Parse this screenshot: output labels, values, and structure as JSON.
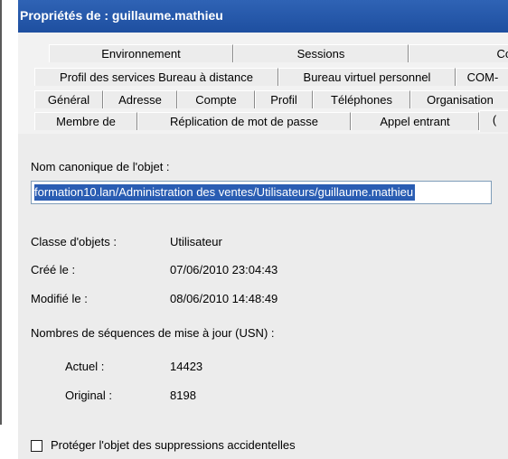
{
  "window": {
    "title": "Propriétés de : guillaume.mathieu"
  },
  "tabs": {
    "row1": [
      "Environnement",
      "Sessions",
      "Cont"
    ],
    "row2": [
      "Profil des services Bureau à distance",
      "Bureau virtuel personnel",
      "COM-"
    ],
    "row3": [
      "Général",
      "Adresse",
      "Compte",
      "Profil",
      "Téléphones",
      "Organisation"
    ],
    "row4": [
      "Membre de",
      "Réplication de mot de passe",
      "Appel entrant",
      "("
    ]
  },
  "object": {
    "canonical_label": "Nom canonique de l'objet :",
    "canonical_value": "formation10.lan/Administration des ventes/Utilisateurs/guillaume.mathieu",
    "class_label": "Classe d'objets :",
    "class_value": "Utilisateur",
    "created_label": "Créé le :",
    "created_value": "07/06/2010 23:04:43",
    "modified_label": "Modifié le :",
    "modified_value": "08/06/2010 14:48:49",
    "usn_label": "Nombres de séquences de mise à jour (USN) :",
    "current_label": "Actuel :",
    "current_value": "14423",
    "original_label": "Original :",
    "original_value": "8198",
    "protect_label": "Protéger l'objet des suppressions accidentelles",
    "protect_checked": false
  }
}
